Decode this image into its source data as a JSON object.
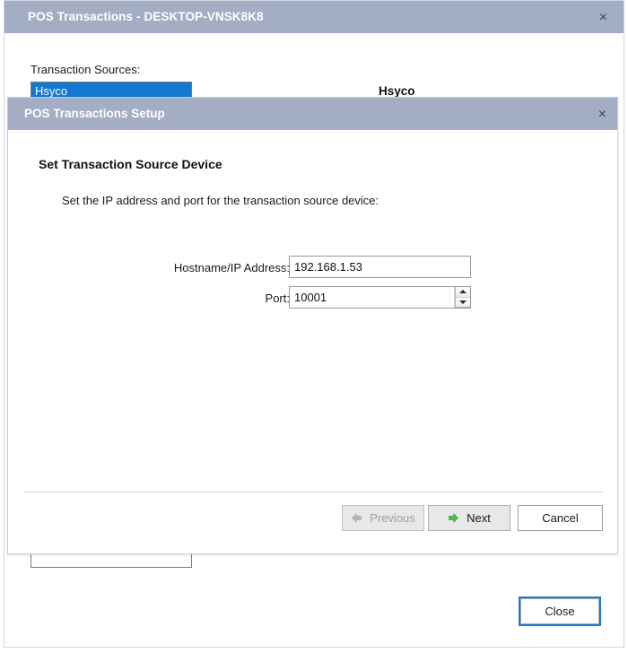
{
  "outer_window": {
    "title": "POS Transactions - DESKTOP-VNSK8K8",
    "close_icon": "×",
    "transaction_sources_label": "Transaction Sources:",
    "list_items": [
      "Hsyco"
    ],
    "detail_heading": "Hsyco",
    "close_button": "Close"
  },
  "dialog": {
    "title": "POS Transactions Setup",
    "close_icon": "×",
    "step_heading": "Set Transaction Source Device",
    "step_description": "Set the IP address and port for the transaction source device:",
    "fields": [
      {
        "label": "Hostname/IP Address:",
        "value": "192.168.1.53",
        "placeholder": ""
      },
      {
        "label": "Port:",
        "value": "10001",
        "placeholder": ""
      }
    ],
    "buttons": {
      "previous": "Previous",
      "next": "Next",
      "cancel": "Cancel"
    }
  },
  "colors": {
    "titlebar": "#a3adc4",
    "selection": "#1477d1",
    "next_arrow": "#3fb83f",
    "previous_arrow": "#b0b0b0",
    "focus_outline": "#1a7ad4"
  }
}
